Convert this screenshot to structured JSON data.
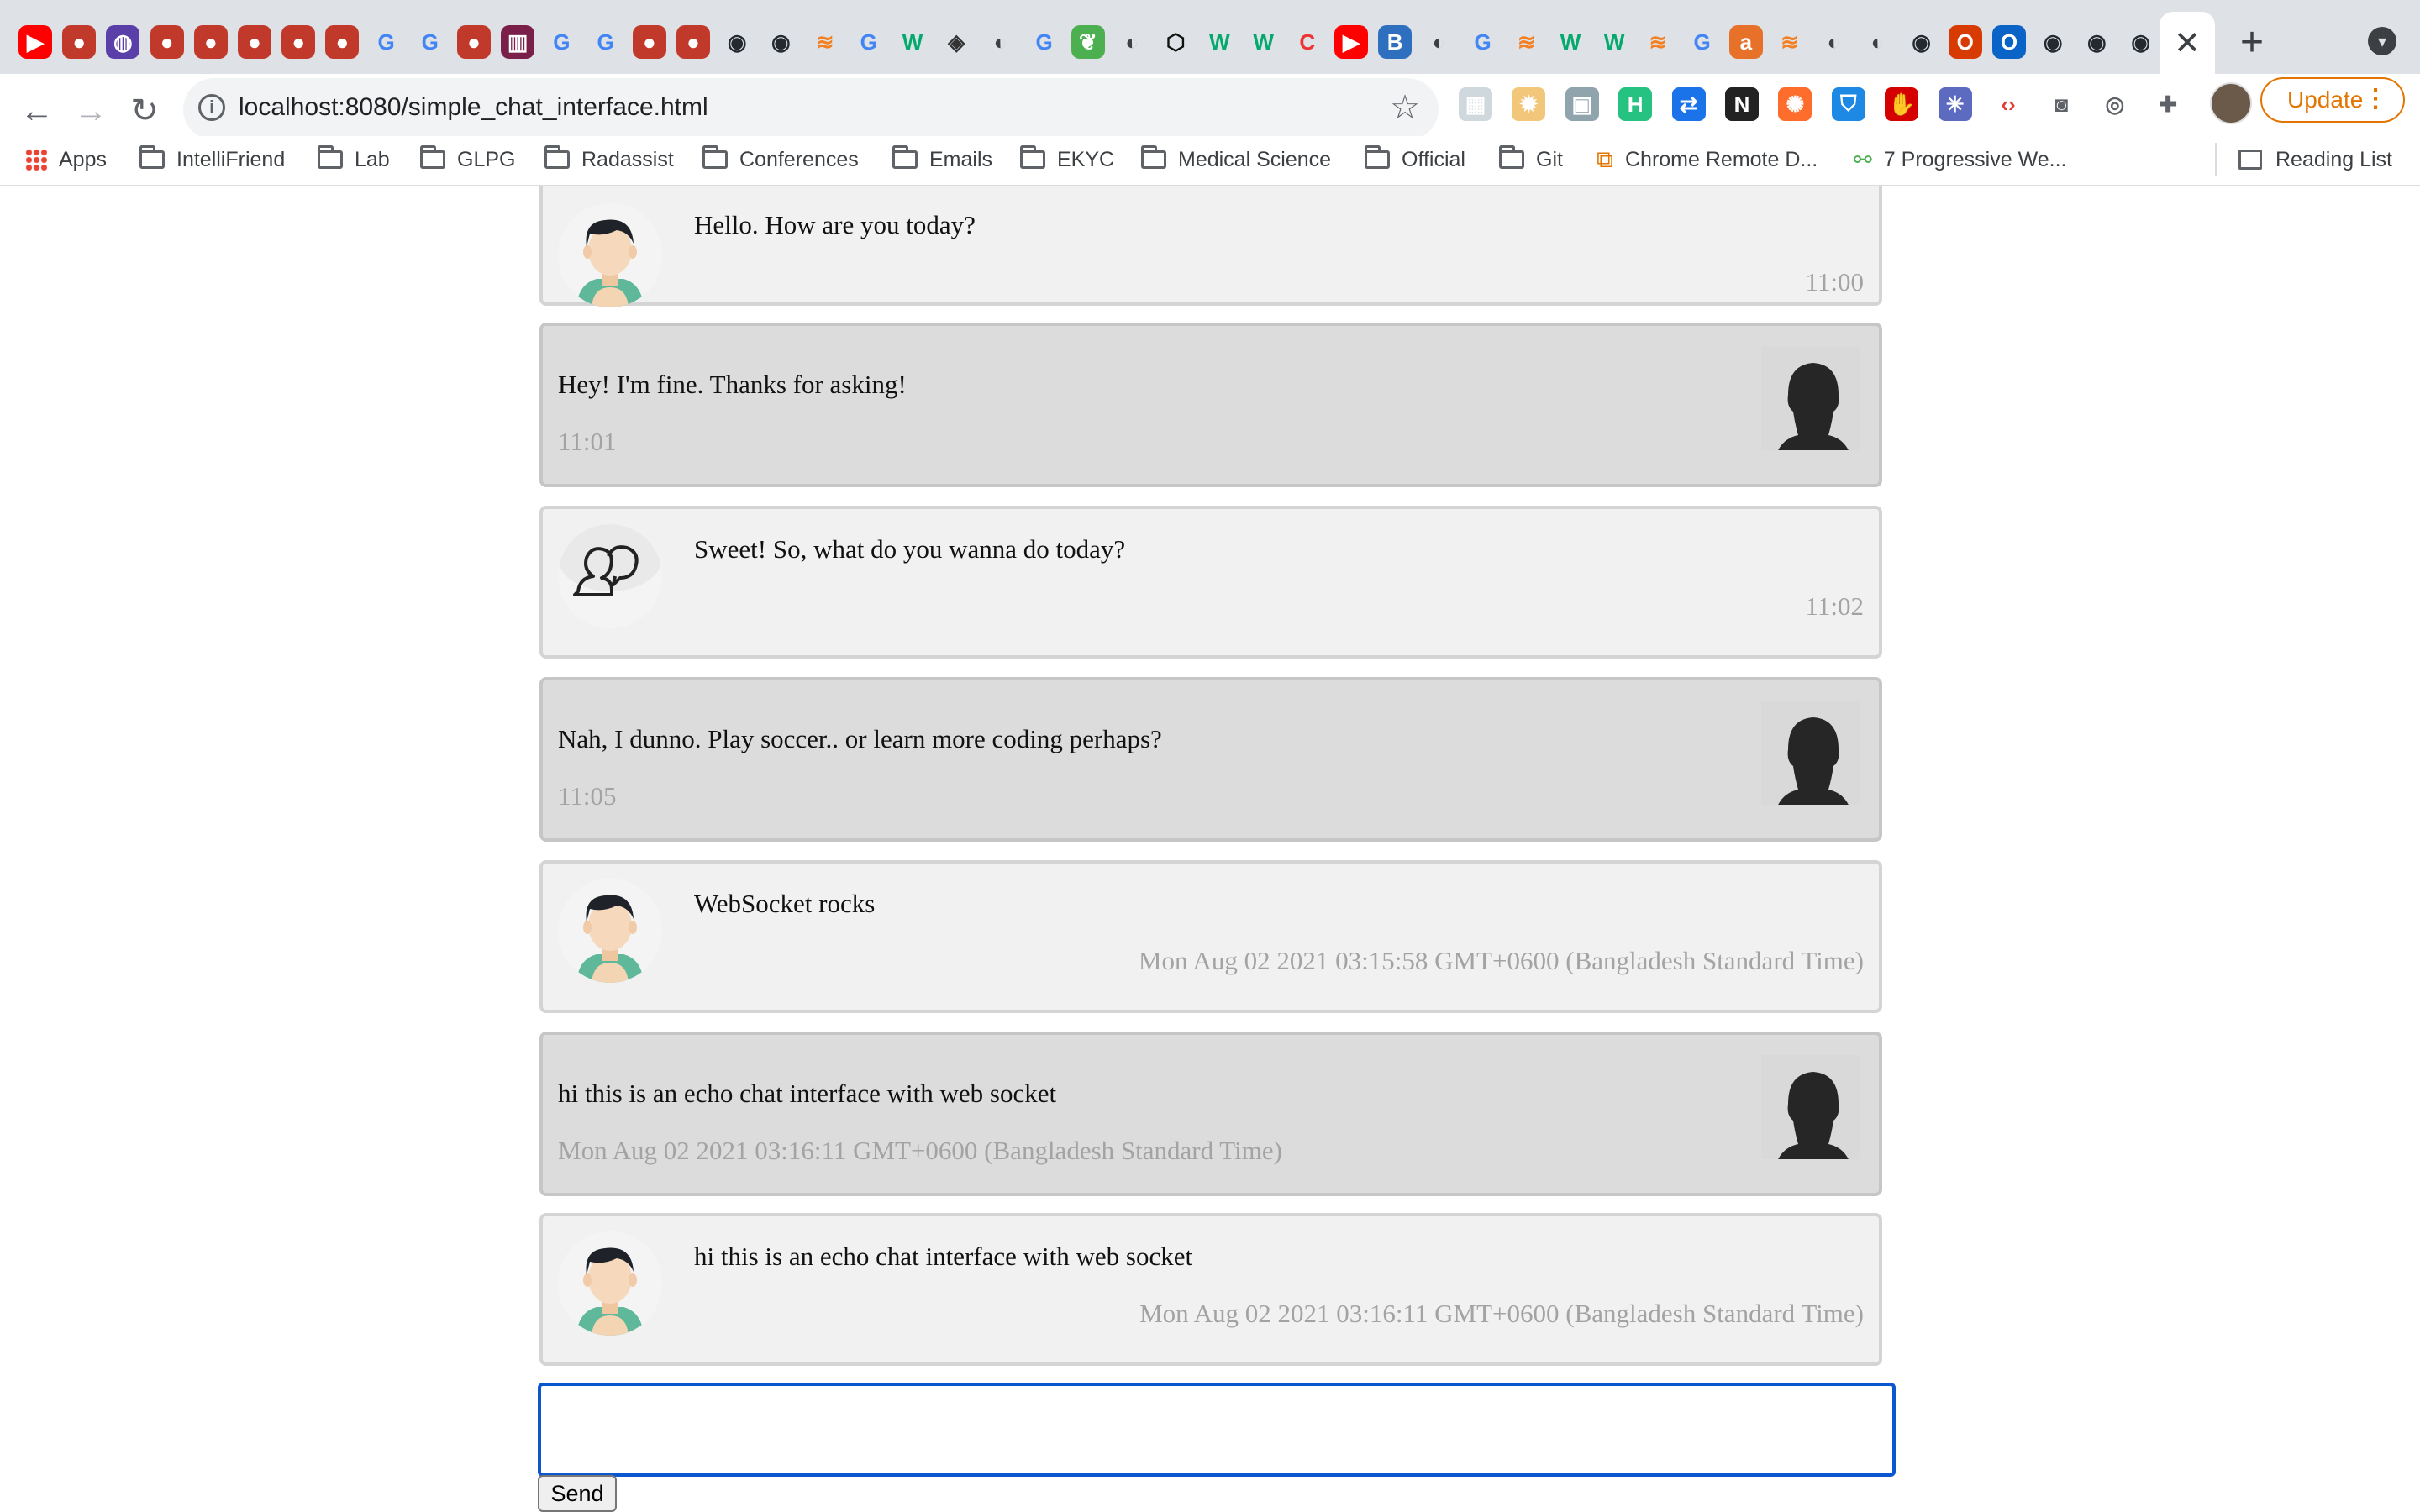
{
  "browser": {
    "url": "localhost:8080/simple_chat_interface.html",
    "update_label": "Update",
    "close_tab_glyph": "✕",
    "new_tab_glyph": "+",
    "tab_icons": [
      "youtube-icon",
      "cluster-icon",
      "firefox-icon",
      "cluster-icon",
      "cluster-icon",
      "cluster-icon",
      "cluster-icon",
      "cluster-icon",
      "google-icon",
      "google-icon",
      "cluster-icon",
      "chart-icon",
      "google-icon",
      "google-icon",
      "cluster-icon",
      "cluster-icon",
      "github-icon",
      "github-icon",
      "stackoverflow-icon",
      "google-icon",
      "w3schools-icon",
      "diamond-icon",
      "globe-icon",
      "google-icon",
      "leaf-icon",
      "globe-icon",
      "codepen-icon",
      "w3schools-icon",
      "w3schools-icon",
      "cc-icon",
      "youtube-icon",
      "bootstrap-icon",
      "globe-icon",
      "google-icon",
      "stackoverflow-icon",
      "w3schools-icon",
      "w3schools-icon",
      "stackoverflow-icon",
      "google-icon",
      "ask-icon",
      "stackoverflow-icon",
      "globe-icon",
      "globe-icon",
      "github-icon",
      "office-icon",
      "outlook-icon",
      "github-icon",
      "github-icon",
      "github-icon"
    ],
    "extension_icons": [
      "grid-ext-icon",
      "gear-ext-icon",
      "image-ext-icon",
      "h-ext-icon",
      "translate-ext-icon",
      "new-ext-icon",
      "orange-ext-icon",
      "shield-ext-icon",
      "hand-ext-icon",
      "sparkle-ext-icon",
      "code-ext-icon",
      "camera-ext-icon",
      "dev-ext-icon",
      "puzzle-icon"
    ]
  },
  "bookmarks": [
    {
      "label": "Apps",
      "icon": "apps-icon"
    },
    {
      "label": "IntelliFriend",
      "icon": "folder-icon"
    },
    {
      "label": "Lab",
      "icon": "folder-icon"
    },
    {
      "label": "GLPG",
      "icon": "folder-icon"
    },
    {
      "label": "Radassist",
      "icon": "folder-icon"
    },
    {
      "label": "Conferences",
      "icon": "folder-icon"
    },
    {
      "label": "Emails",
      "icon": "folder-icon"
    },
    {
      "label": "EKYC",
      "icon": "folder-icon"
    },
    {
      "label": "Medical Science",
      "icon": "folder-icon"
    },
    {
      "label": "Official",
      "icon": "folder-icon"
    },
    {
      "label": "Git",
      "icon": "folder-icon"
    },
    {
      "label": "Chrome Remote D...",
      "icon": "remote-icon"
    },
    {
      "label": "7 Progressive We...",
      "icon": "pwa-icon"
    }
  ],
  "reading_list": "Reading List",
  "messages": [
    {
      "text": "Hello. How are you today?",
      "time": "11:00",
      "side": "recv",
      "avatar": "man-avatar"
    },
    {
      "text": "Hey! I'm fine. Thanks for asking!",
      "time": "11:01",
      "side": "sent",
      "avatar": "silhouette-avatar"
    },
    {
      "text": "Sweet! So, what do you wanna do today?",
      "time": "11:02",
      "side": "recv",
      "avatar": "chat-bubbles-avatar"
    },
    {
      "text": "Nah, I dunno. Play soccer.. or learn more coding perhaps?",
      "time": "11:05",
      "side": "sent",
      "avatar": "silhouette-avatar"
    },
    {
      "text": "WebSocket rocks",
      "time": "Mon Aug 02 2021 03:15:58 GMT+0600 (Bangladesh Standard Time)",
      "side": "recv",
      "avatar": "man-avatar"
    },
    {
      "text": "hi this is an echo chat interface with web socket",
      "time": "Mon Aug 02 2021 03:16:11 GMT+0600 (Bangladesh Standard Time)",
      "side": "sent",
      "avatar": "silhouette-avatar"
    },
    {
      "text": "hi this is an echo chat interface with web socket",
      "time": "Mon Aug 02 2021 03:16:11 GMT+0600 (Bangladesh Standard Time)",
      "side": "recv",
      "avatar": "man-avatar"
    }
  ],
  "composer": {
    "value": "",
    "send_label": "Send"
  },
  "colors": {
    "received_bubble": "#f1f1f1",
    "sent_bubble": "#dcdcdc",
    "timestamp": "#a3a3a3",
    "input_focus": "#0b57d0",
    "update_accent": "#e37400"
  }
}
